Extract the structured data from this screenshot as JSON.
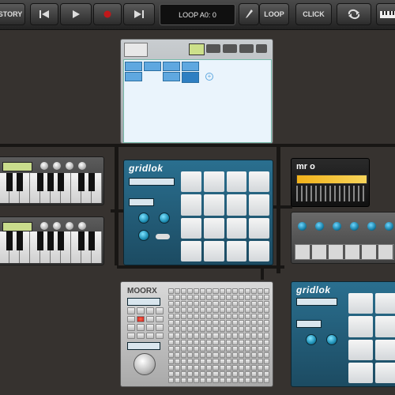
{
  "toolbar": {
    "story_label": "STORY",
    "lcd_text": "LOOP A0: 0",
    "loop_label": "LOOP",
    "click_label": "CLICK"
  },
  "colors": {
    "background": "#36322f",
    "gridlok_blue": "#2a6f8f",
    "pad_white": "#f0f0f0",
    "record_red": "#c0181a",
    "seq_blue": "#5fa8e0"
  },
  "icons": [
    "rewind-icon",
    "play-icon",
    "record-icon",
    "forward-icon",
    "pencil-icon",
    "loop-arrows-icon",
    "keyboard-icon"
  ],
  "devices": {
    "gridlok_top": {
      "logo": "gridlok"
    },
    "gridlok_bottom": {
      "logo": "gridlok"
    },
    "moorx": {
      "logo": "MOORX"
    },
    "mro": {
      "logo": "mr o"
    }
  }
}
